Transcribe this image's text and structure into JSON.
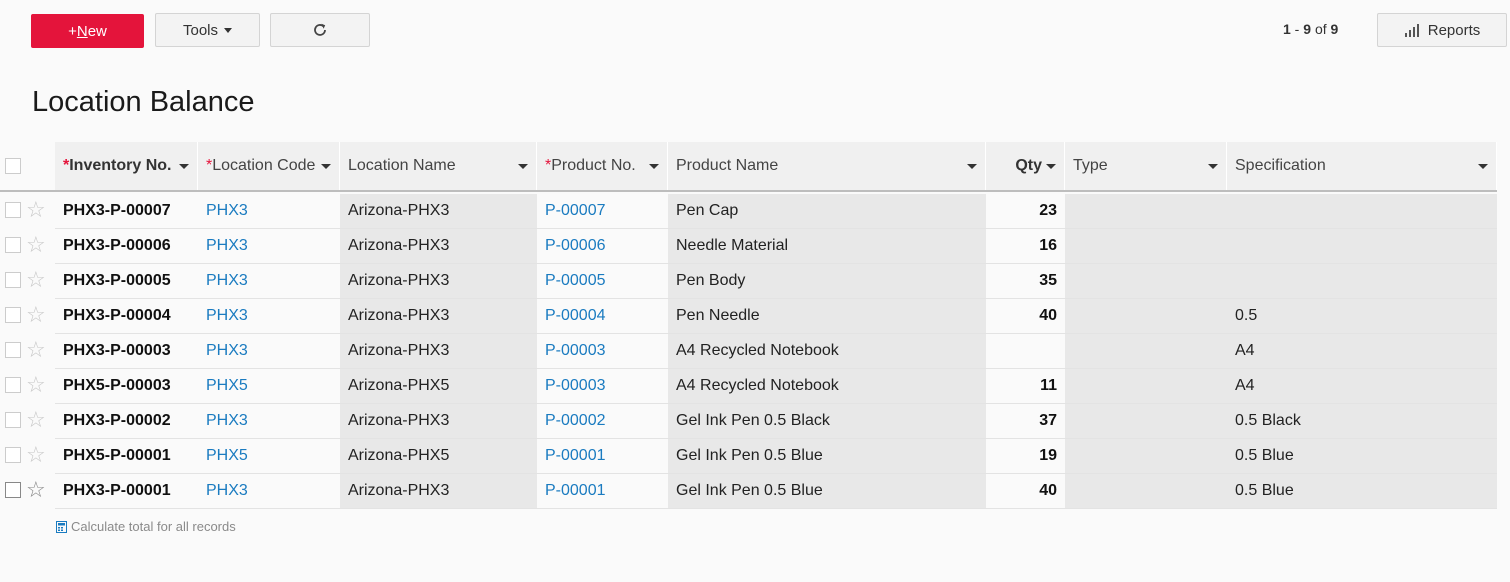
{
  "toolbar": {
    "new_prefix": "+",
    "new_label_underlined": "N",
    "new_label_rest": "ew",
    "tools_label": "Tools",
    "reports_label": "Reports"
  },
  "paging": {
    "from": "1",
    "to": "9",
    "of_label": "of",
    "total": "9"
  },
  "page_title": "Location Balance",
  "columns": {
    "inventory_no": "Inventory No.",
    "location_code": "Location Code",
    "location_name": "Location Name",
    "product_no": "Product No.",
    "product_name": "Product Name",
    "qty": "Qty",
    "type": "Type",
    "specification": "Specification",
    "required_mark": "*"
  },
  "rows": [
    {
      "inventory_no": "PHX3-P-00007",
      "location_code": "PHX3",
      "location_name": "Arizona-PHX3",
      "product_no": "P-00007",
      "product_name": "Pen Cap",
      "qty": "23",
      "type": "",
      "specification": ""
    },
    {
      "inventory_no": "PHX3-P-00006",
      "location_code": "PHX3",
      "location_name": "Arizona-PHX3",
      "product_no": "P-00006",
      "product_name": "Needle Material",
      "qty": "16",
      "type": "",
      "specification": ""
    },
    {
      "inventory_no": "PHX3-P-00005",
      "location_code": "PHX3",
      "location_name": "Arizona-PHX3",
      "product_no": "P-00005",
      "product_name": "Pen Body",
      "qty": "35",
      "type": "",
      "specification": ""
    },
    {
      "inventory_no": "PHX3-P-00004",
      "location_code": "PHX3",
      "location_name": "Arizona-PHX3",
      "product_no": "P-00004",
      "product_name": "Pen Needle",
      "qty": "40",
      "type": "",
      "specification": "0.5"
    },
    {
      "inventory_no": "PHX3-P-00003",
      "location_code": "PHX3",
      "location_name": "Arizona-PHX3",
      "product_no": "P-00003",
      "product_name": "A4 Recycled Notebook",
      "qty": "",
      "type": "",
      "specification": "A4"
    },
    {
      "inventory_no": "PHX5-P-00003",
      "location_code": "PHX5",
      "location_name": "Arizona-PHX5",
      "product_no": "P-00003",
      "product_name": "A4 Recycled Notebook",
      "qty": "11",
      "type": "",
      "specification": "A4"
    },
    {
      "inventory_no": "PHX3-P-00002",
      "location_code": "PHX3",
      "location_name": "Arizona-PHX3",
      "product_no": "P-00002",
      "product_name": "Gel Ink Pen 0.5 Black",
      "qty": "37",
      "type": "",
      "specification": "0.5 Black"
    },
    {
      "inventory_no": "PHX5-P-00001",
      "location_code": "PHX5",
      "location_name": "Arizona-PHX5",
      "product_no": "P-00001",
      "product_name": "Gel Ink Pen 0.5 Blue",
      "qty": "19",
      "type": "",
      "specification": "0.5 Blue"
    },
    {
      "inventory_no": "PHX3-P-00001",
      "location_code": "PHX3",
      "location_name": "Arizona-PHX3",
      "product_no": "P-00001",
      "product_name": "Gel Ink Pen 0.5 Blue",
      "qty": "40",
      "type": "",
      "specification": "0.5 Blue"
    }
  ],
  "footer": {
    "calc_total_label": "Calculate total for all records"
  },
  "colors": {
    "accent": "#e4143b",
    "link": "#1a7bc0"
  },
  "icons": {
    "refresh": "refresh-icon",
    "reports": "bar-chart-icon",
    "star": "star-icon",
    "calculator": "calculator-icon"
  }
}
